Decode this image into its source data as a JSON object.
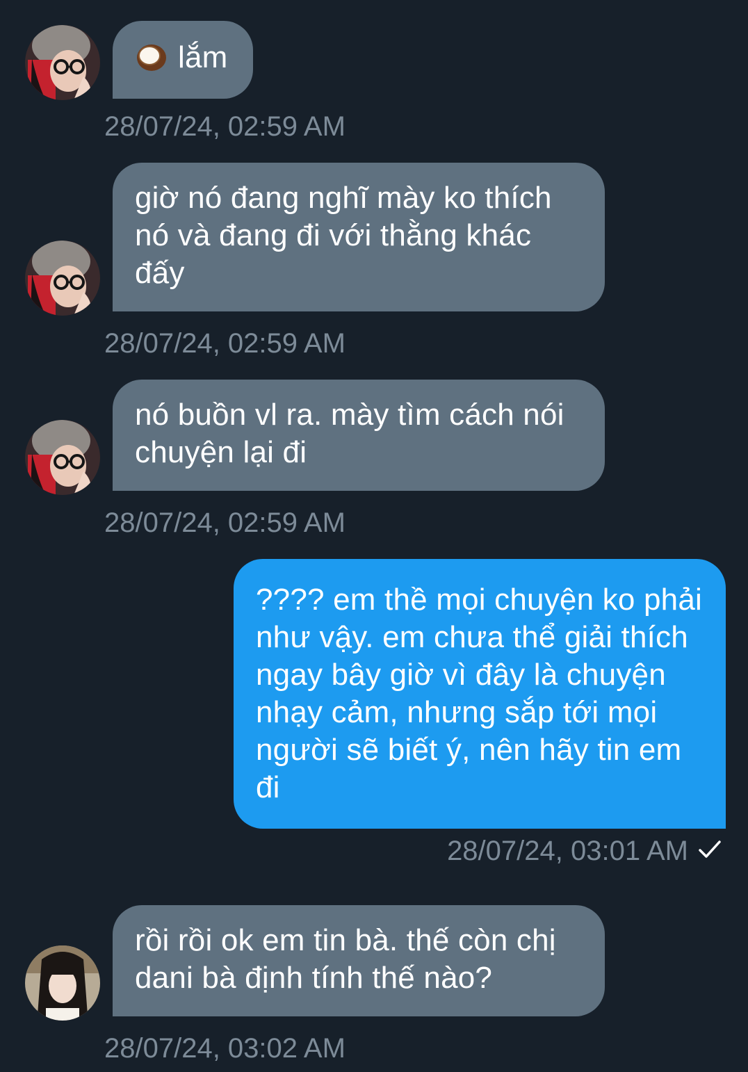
{
  "messages": [
    {
      "id": "m1",
      "direction": "incoming",
      "sender": "person-a",
      "emoji": "coconut-emoji",
      "text": "lắm",
      "timestamp": "28/07/24, 02:59 AM"
    },
    {
      "id": "m2",
      "direction": "incoming",
      "sender": "person-a",
      "text": "giờ nó đang nghĩ mày ko thích nó và đang đi với thằng khác đấy",
      "timestamp": "28/07/24, 02:59 AM"
    },
    {
      "id": "m3",
      "direction": "incoming",
      "sender": "person-a",
      "text": "nó buồn vl ra. mày tìm cách nói chuyện lại đi",
      "timestamp": "28/07/24, 02:59 AM"
    },
    {
      "id": "m4",
      "direction": "outgoing",
      "text": "???? em thề mọi chuyện ko phải như vậy. em chưa thể giải thích ngay bây giờ vì đây là chuyện nhạy cảm, nhưng sắp tới mọi người sẽ biết ý, nên hãy tin em đi",
      "timestamp": "28/07/24, 03:01 AM",
      "status_icon": "check-icon"
    },
    {
      "id": "m5",
      "direction": "incoming",
      "sender": "person-b",
      "text": "rồi rồi ok em tin bà. thế còn chị dani bà định tính thế nào?",
      "timestamp": "28/07/24, 03:02 AM"
    }
  ],
  "colors": {
    "background": "#17202a",
    "incoming_bubble": "#5f7180",
    "outgoing_bubble": "#1d9bf0",
    "timestamp": "#7d8b98",
    "text": "#ffffff"
  }
}
